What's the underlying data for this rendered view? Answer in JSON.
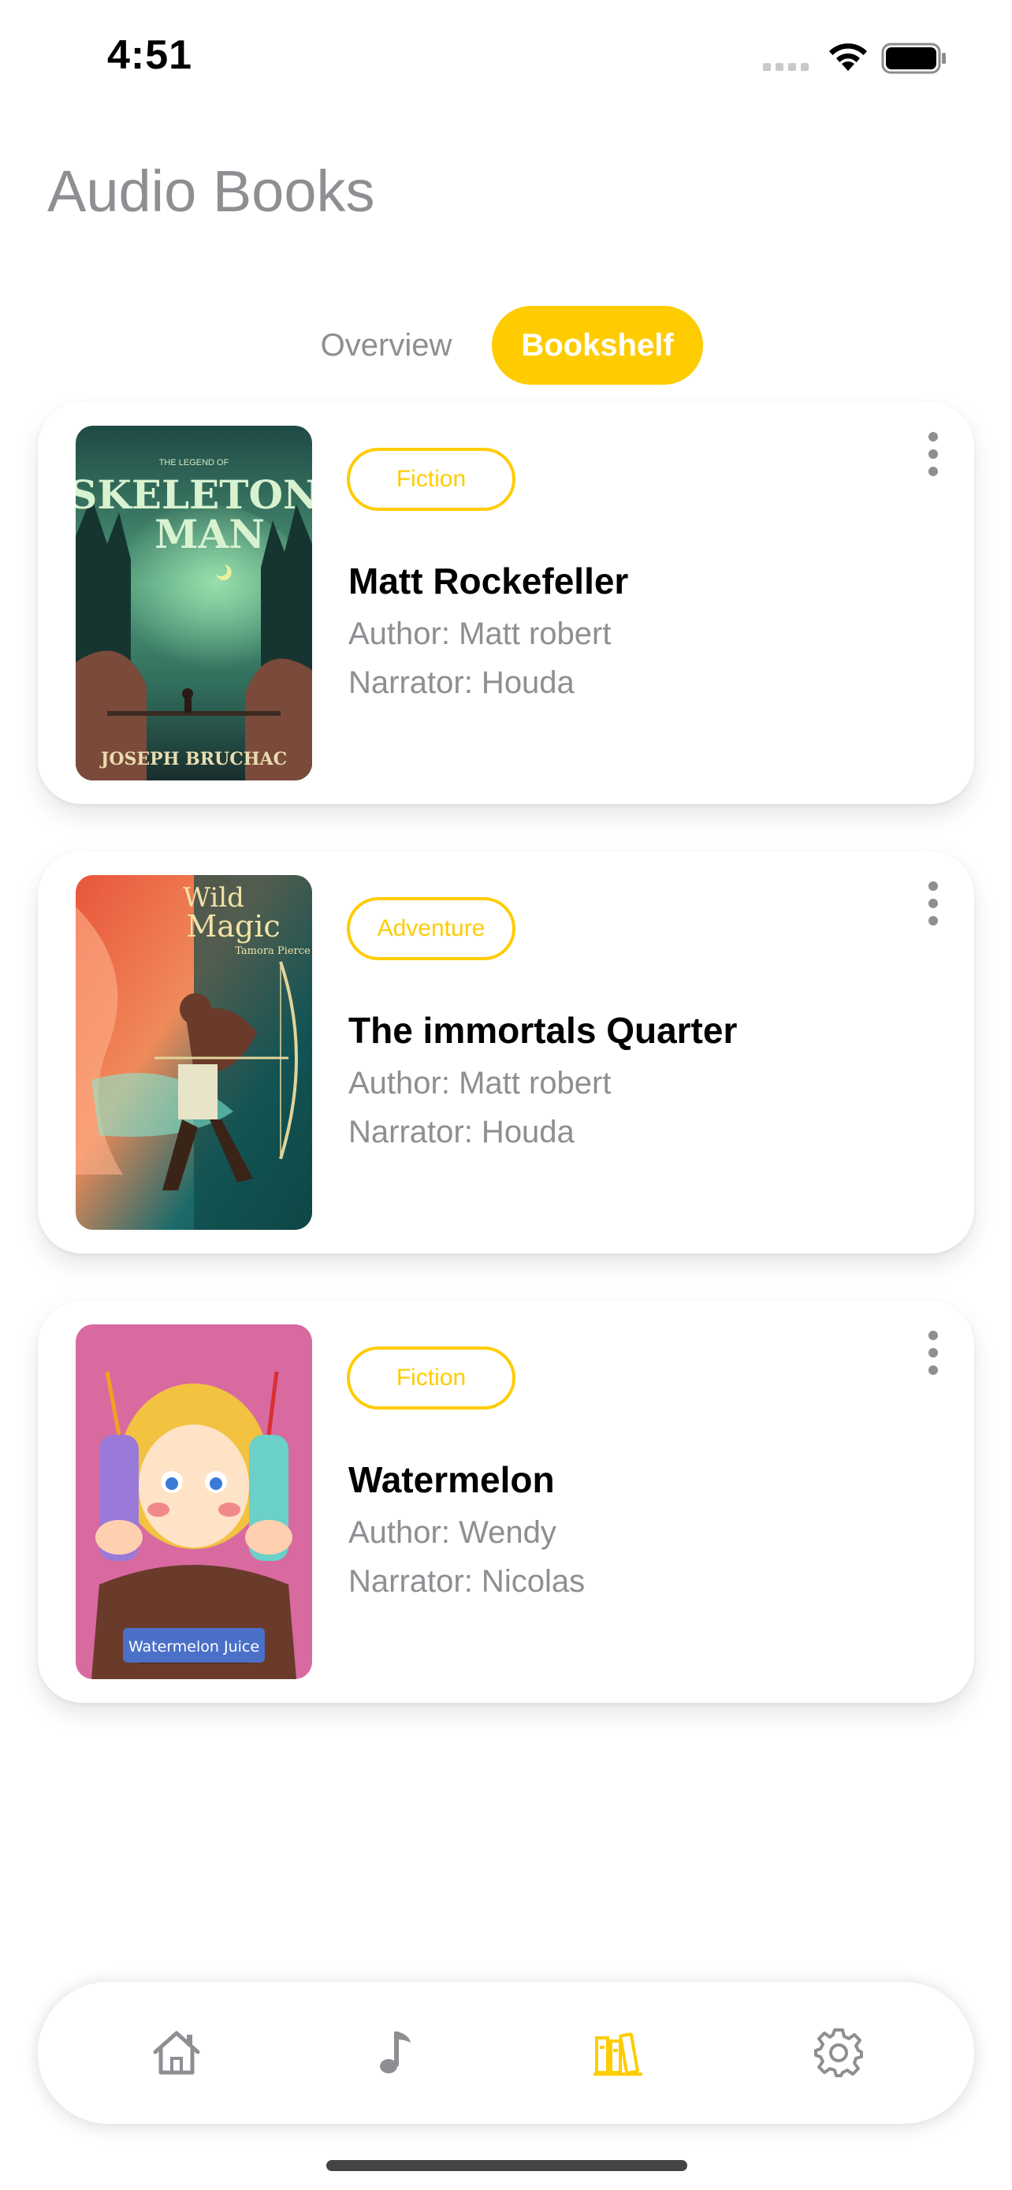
{
  "status_bar": {
    "time": "4:51",
    "icons": [
      "cellular-signal-icon",
      "wifi-icon",
      "battery-icon"
    ]
  },
  "header": {
    "title": "Audio Books"
  },
  "tabs": {
    "overview_label": "Overview",
    "bookshelf_label": "Bookshelf",
    "selected": "Bookshelf"
  },
  "colors": {
    "accent": "#ffcc02",
    "secondary_text": "#8e8e93",
    "primary_text": "#000000"
  },
  "books": [
    {
      "genre": "Fiction",
      "title": "Matt Rockefeller",
      "author": "Author: Matt robert",
      "narrator": "Narrator: Houda",
      "cover": {
        "top_text": "THE LEGEND OF",
        "title_line1": "SKELETON",
        "title_line2": "MAN",
        "author_text": "JOSEPH BRUCHAC"
      }
    },
    {
      "genre": "Adventure",
      "title": "The immortals Quarter",
      "author": "Author: Matt robert",
      "narrator": "Narrator: Houda",
      "cover": {
        "title_line1": "Wild",
        "title_line2": "Magic",
        "author_text": "Tamora Pierce"
      }
    },
    {
      "genre": "Fiction",
      "title": "Watermelon",
      "author": "Author: Wendy",
      "narrator": "Narrator: Nicolas",
      "cover": {
        "banner_text": "Watermelon Juice"
      }
    }
  ],
  "tab_bar": {
    "items": [
      "home-icon",
      "music-note-icon",
      "bookshelf-icon",
      "settings-gear-icon"
    ],
    "active": "bookshelf-icon"
  }
}
